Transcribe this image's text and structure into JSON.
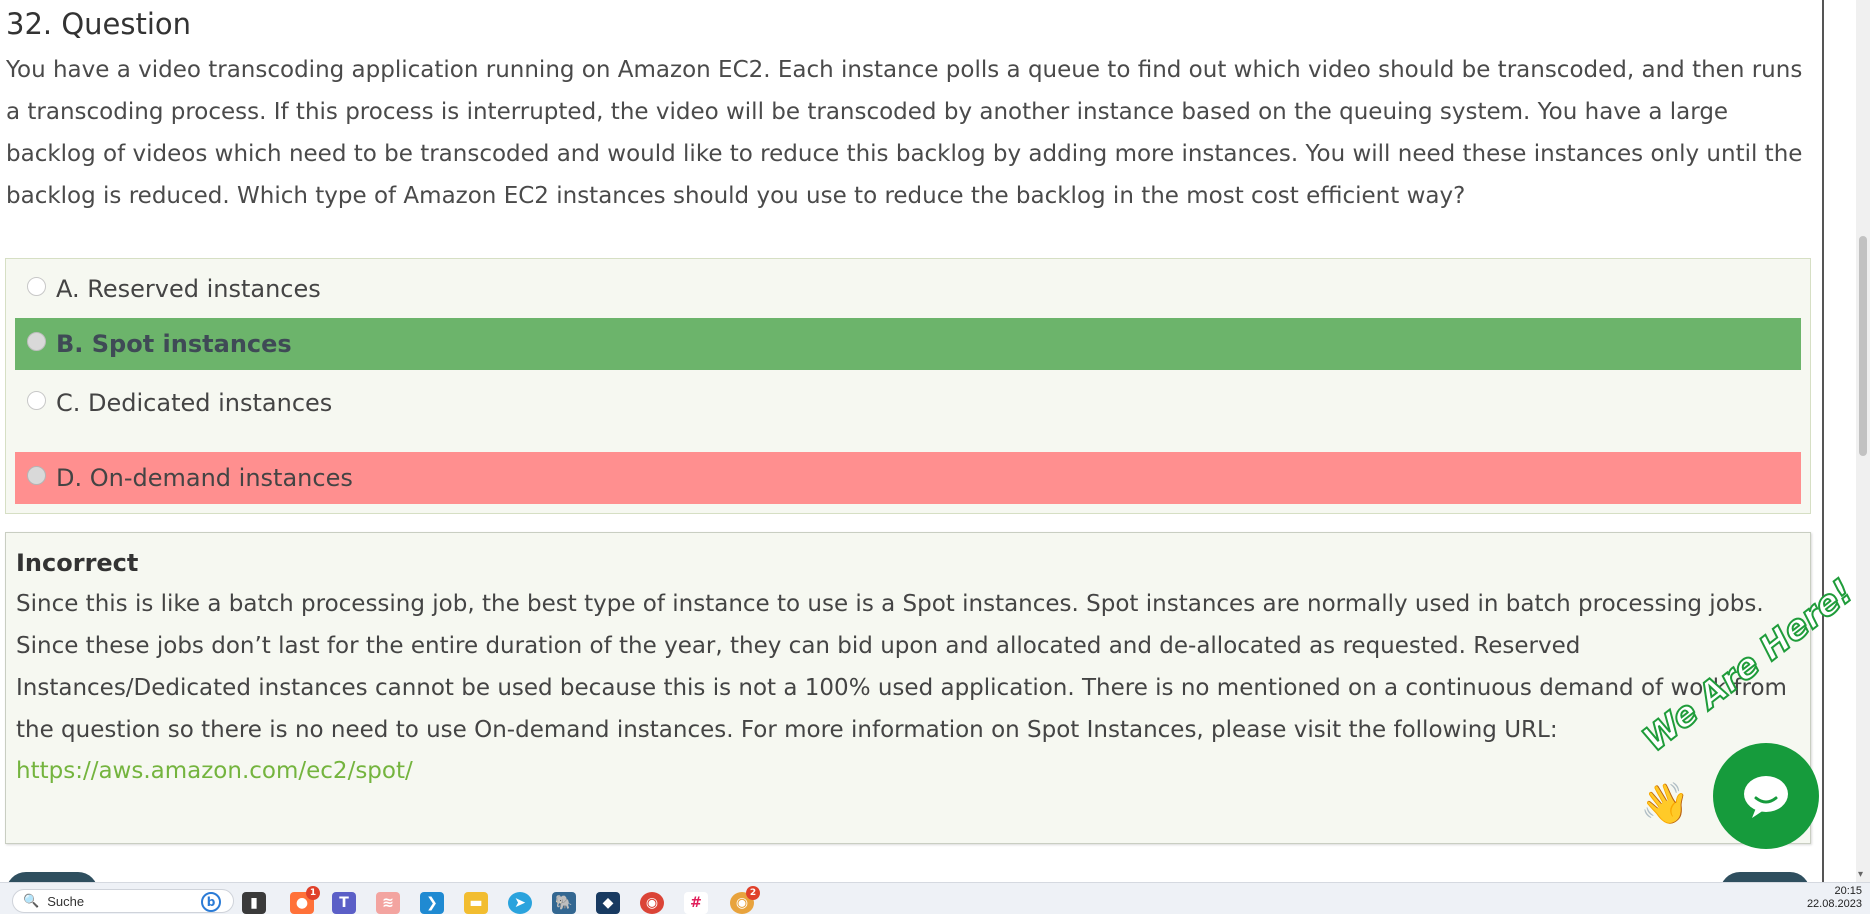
{
  "question": {
    "title": "32. Question",
    "text": "You have a video transcoding application running on Amazon EC2. Each instance polls a queue to find out which video should be transcoded, and then runs a transcoding process. If this process is interrupted, the video will be transcoded by another instance based on the queuing system. You have a large backlog of videos which need to be transcoded and would like to reduce this backlog by adding more instances. You will need these instances only until the backlog is reduced. Which type of Amazon EC2 instances should you use to reduce the backlog in the most cost efficient way?"
  },
  "options": [
    {
      "label": "A. Reserved instances",
      "state": "neutral"
    },
    {
      "label": "B. Spot instances",
      "state": "correct"
    },
    {
      "label": "C. Dedicated instances",
      "state": "neutral"
    },
    {
      "label": "D. On-demand instances",
      "state": "selected-wrong"
    }
  ],
  "explanation": {
    "result": "Incorrect",
    "text": "Since this is like a batch processing job, the best type of instance to use is a Spot instances. Spot instances are normally used in batch processing jobs. Since these jobs don’t last for the entire duration of the year, they can bid upon and allocated and de-allocated as requested. Reserved Instances/Dedicated instances cannot be used because this is not a 100% used application. There is no mentioned on a continuous demand of work from the question so there is no need to use On-demand instances. For more information on Spot Instances, please visit the following URL:",
    "link": "https://aws.amazon.com/ec2/spot/"
  },
  "chat_widget": {
    "text": "We Are Here!"
  },
  "colors": {
    "correct": "#6cb46b",
    "wrong": "#ff8f8f",
    "link": "#74b43e",
    "chat": "#169b3c"
  },
  "taskbar": {
    "search_label": "Suche",
    "clock_time": "20:15",
    "clock_date": "22.08.2023",
    "icons": [
      {
        "name": "task-view-icon",
        "badge": ""
      },
      {
        "name": "firefox-icon",
        "badge": "1"
      },
      {
        "name": "teams-icon",
        "badge": ""
      },
      {
        "name": "stack-icon",
        "badge": ""
      },
      {
        "name": "vscode-icon",
        "badge": ""
      },
      {
        "name": "file-explorer-icon",
        "badge": ""
      },
      {
        "name": "telegram-icon",
        "badge": ""
      },
      {
        "name": "postgres-icon",
        "badge": ""
      },
      {
        "name": "virtualbox-icon",
        "badge": ""
      },
      {
        "name": "chrome-icon",
        "badge": ""
      },
      {
        "name": "slack-icon",
        "badge": ""
      },
      {
        "name": "chrome-canary-icon",
        "badge": "2"
      }
    ]
  }
}
